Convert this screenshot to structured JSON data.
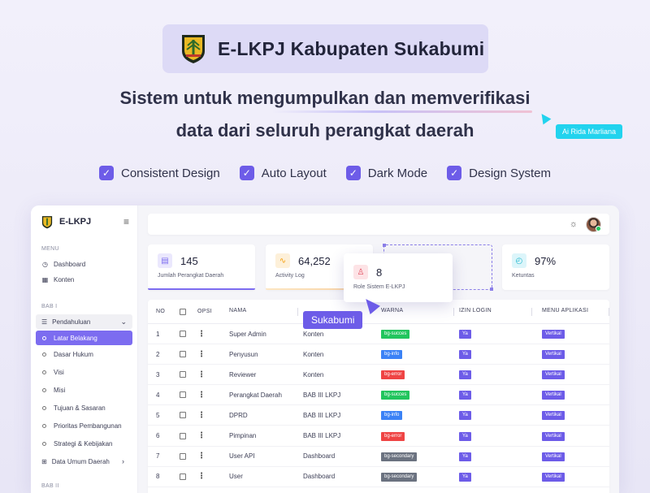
{
  "hero": {
    "title": "E-LKPJ Kabupaten Sukabumi",
    "subtitle_line1": "Sistem untuk mengumpulkan dan memverifikasi",
    "subtitle_line2": "data dari seluruh perangkat daerah",
    "cursor_tag": "Ai Rida Marliana",
    "features": [
      "Consistent Design",
      "Auto Layout",
      "Dark Mode",
      "Design System"
    ]
  },
  "sidebar": {
    "brand": "E-LKPJ",
    "section_menu": "MENU",
    "menu_items": [
      "Dashboard",
      "Konten"
    ],
    "section_bab1": "BAB I",
    "group_label": "Pendahuluan",
    "sub_items": [
      "Latar Belakang",
      "Dasar Hukum",
      "Visi",
      "Misi",
      "Tujuan & Sasaran",
      "Prioritas Pembangunan",
      "Strategi & Kebijakan"
    ],
    "active_index": 0,
    "data_umum": "Data Umum Daerah",
    "section_bab2": "BAB II"
  },
  "stats": [
    {
      "value": "145",
      "label": "Jumlah Perangkat Daerah",
      "color": "#7c6cf0"
    },
    {
      "value": "64,252",
      "label": "Activity Log",
      "color": "#f59e0b"
    },
    {
      "value": "8",
      "label": "Role Sistem E-LKPJ",
      "color": "#e04b5c"
    },
    {
      "value": "97%",
      "label": "Ketuntas",
      "color": "#22b8cf"
    }
  ],
  "table": {
    "headers": {
      "no": "NO",
      "opsi": "OPSI",
      "nama": "NAMA",
      "warna": "WARNA",
      "izin": "IZIN LOGIN",
      "menu": "MENU APLIKASI"
    },
    "rows": [
      {
        "no": "1",
        "nama": "Super Admin",
        "akses": "Konten",
        "warna": "bg-succes",
        "warna_type": "success",
        "izin": "Ya",
        "menu": "Vertikal"
      },
      {
        "no": "2",
        "nama": "Penyusun",
        "akses": "Konten",
        "warna": "bg-info",
        "warna_type": "info",
        "izin": "Ya",
        "menu": "Vertikal"
      },
      {
        "no": "3",
        "nama": "Reviewer",
        "akses": "Konten",
        "warna": "bg-error",
        "warna_type": "error",
        "izin": "Ya",
        "menu": "Vertikal"
      },
      {
        "no": "4",
        "nama": "Perangkat Daerah",
        "akses": "BAB III LKPJ",
        "warna": "bg-succes",
        "warna_type": "success",
        "izin": "Ya",
        "menu": "Vertikal"
      },
      {
        "no": "5",
        "nama": "DPRD",
        "akses": "BAB III LKPJ",
        "warna": "bg-info",
        "warna_type": "info",
        "izin": "Ya",
        "menu": "Vertikal"
      },
      {
        "no": "6",
        "nama": "Pimpinan",
        "akses": "BAB III LKPJ",
        "warna": "bg-error",
        "warna_type": "error",
        "izin": "Ya",
        "menu": "Vertikal"
      },
      {
        "no": "7",
        "nama": "User API",
        "akses": "Dashboard",
        "warna": "bg-secondary",
        "warna_type": "secondary",
        "izin": "Ya",
        "menu": "Vertikal"
      },
      {
        "no": "8",
        "nama": "User",
        "akses": "Dashboard",
        "warna": "bg-secondary",
        "warna_type": "secondary",
        "izin": "Ya",
        "menu": "Vertikal"
      }
    ]
  },
  "cursor_label": "Sukabumi",
  "colors": {
    "accent": "#6d5ce8",
    "cyan": "#22d3ee"
  }
}
